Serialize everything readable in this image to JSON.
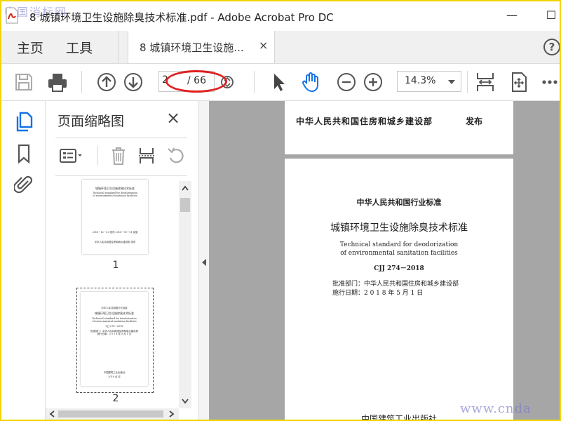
{
  "window": {
    "title": "8 城镇环境卫生设施除臭技术标准.pdf - Adobe Acrobat Pro DC",
    "minimize_glyph": "—",
    "maximize_glyph": "☐",
    "watermark_top": "中国消标网"
  },
  "tabs": {
    "home": "主页",
    "tools": "工具",
    "document": "8 城镇环境卫生设施...",
    "close_glyph": "×",
    "help_glyph": "?"
  },
  "toolbar": {
    "page_current": "2",
    "page_total": "/ 66",
    "zoom": "14.3%",
    "icons": [
      "save-icon",
      "print-icon",
      "page-up-icon",
      "page-down-icon",
      "select-arrow-icon",
      "hand-icon",
      "zoom-out-icon",
      "zoom-in-icon",
      "fit-page-icon",
      "scroll-mode-icon",
      "more-icon"
    ]
  },
  "sidebar_rail": {
    "icons": [
      "page-thumbnails-icon",
      "bookmark-icon",
      "attachment-icon"
    ]
  },
  "thumbnail_pane": {
    "title": "页面缩略图",
    "close_glyph": "×",
    "thumbnails": [
      {
        "page_number": "1",
        "lines": [
          "城镇环境卫生设施除臭技术标准",
          "Technical standard for deodorization",
          "of environmental sanitation facilities",
          "2018－12－20 发布          2018－05－01 实施",
          "中华人民共和国住房和城乡建设部    发布"
        ]
      },
      {
        "page_number": "2",
        "lines": [
          "中华人民共和国行业标准",
          "城镇环境卫生设施除臭技术标准",
          "Technical standard for deodorization",
          "of environmental sanitation facilities",
          "CJJ 274－2018",
          "批准部门：中华人民共和国住房和城乡建设部",
          "施行日期：2 0 1 8 年 5 月 1 日",
          "中国建筑工业出版社",
          "2018 北 京"
        ]
      }
    ]
  },
  "document": {
    "page1_publisher": "中华人民共和国住房和城乡建设部",
    "page1_publish_word": "发布",
    "page2": {
      "category": "中华人民共和国行业标准",
      "title_cn": "城镇环境卫生设施除臭技术标准",
      "title_en_1": "Technical standard for deodorization",
      "title_en_2": "of environmental sanitation facilities",
      "code": "CJJ 274－2018",
      "approval": "批准部门：中华人民共和国住房和城乡建设部",
      "effective": "施行日期：2 0 1 8 年 5 月 1 日",
      "publisher": "中国建筑工业出版社"
    }
  },
  "watermark_bottom": "www.cnda",
  "colors": {
    "border": "#f2d400",
    "hand_tool_active": "#1473e6",
    "annotation_oval": "#e02020",
    "doc_background": "#a6a6a6"
  }
}
